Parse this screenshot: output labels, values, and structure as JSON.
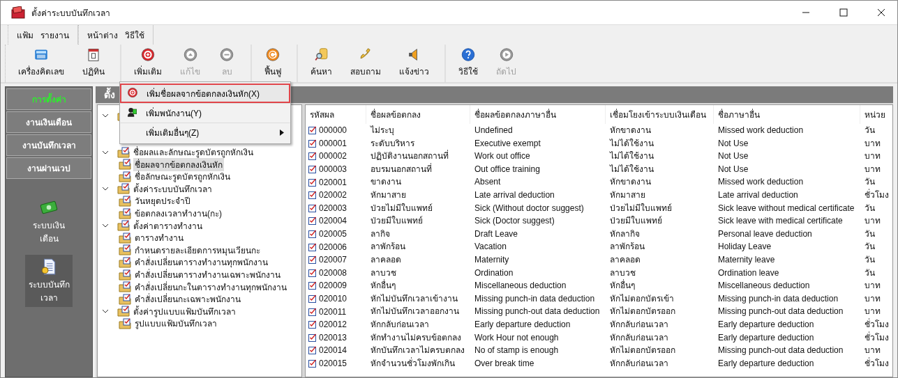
{
  "window": {
    "title": "ตั้งค่าระบบบันทึกเวลา"
  },
  "menu_groups": [
    [
      "แฟ้ม",
      "รายงาน"
    ],
    [
      "หน้าต่าง",
      "วิธีใช้"
    ]
  ],
  "toolbar_groups": [
    [
      {
        "label": "เครื่องคิดเลข",
        "disabled": false
      },
      {
        "label": "ปฏิทิน",
        "disabled": false
      }
    ],
    [
      {
        "label": "เพิ่มเติม",
        "disabled": false
      },
      {
        "label": "แก้ไข",
        "disabled": true
      },
      {
        "label": "ลบ",
        "disabled": true
      }
    ],
    [
      {
        "label": "ฟื้นฟู",
        "disabled": false
      }
    ],
    [
      {
        "label": "ค้นหา",
        "disabled": false
      },
      {
        "label": "สอบถาม",
        "disabled": false
      },
      {
        "label": "แจ้งข่าว",
        "disabled": false
      }
    ],
    [
      {
        "label": "วิธีใช้",
        "disabled": false
      },
      {
        "label": "ถัดไป",
        "disabled": true
      }
    ]
  ],
  "nav_buttons": [
    {
      "label": "การตั้งค่า",
      "selected": true
    },
    {
      "label": "งานเงินเดือน",
      "selected": false
    },
    {
      "label": "งานบันทึกเวลา",
      "selected": false
    },
    {
      "label": "งานผ่านเวป",
      "selected": false
    }
  ],
  "nav_modules": [
    {
      "label": "ระบบเงินเดือน",
      "selected": false
    },
    {
      "label": "ระบบบันทึกเวลา",
      "selected": true
    }
  ],
  "panel": {
    "title": "ตั้ง"
  },
  "tree": [
    {
      "expanded": true
    },
    {
      "label": "ชื่อผลและลักษณะรูดบัตรถูกหักเงิน",
      "expanded": true,
      "children": [
        {
          "label": "ชื่อผลจากข้อตกลงเงินหัก",
          "selected": true
        },
        {
          "label": "ชื่อลักษณะรูดบัตรถูกหักเงิน",
          "selected": false
        }
      ]
    },
    {
      "label": "ตั้งค่าระบบบันทึกเวลา",
      "expanded": true,
      "children": [
        {
          "label": "วันหยุดประจำปี",
          "selected": false
        },
        {
          "label": "ข้อตกลงเวลาทำงาน(กะ)",
          "selected": false
        }
      ]
    },
    {
      "label": "ตั้งค่าตารางทำงาน",
      "expanded": true,
      "children": [
        {
          "label": "ตารางทำงาน",
          "selected": false
        },
        {
          "label": "กำหนดรายละเอียดการหมุนเวียนกะ",
          "selected": false
        },
        {
          "label": "คำสั่งเปลี่ยนตารางทำงานทุกพนักงาน",
          "selected": false
        },
        {
          "label": "คำสั่งเปลี่ยนตารางทำงานเฉพาะพนักงาน",
          "selected": false
        },
        {
          "label": "คำสั่งเปลี่ยนกะในตารางทำงานทุกพนักงาน",
          "selected": false
        },
        {
          "label": "คำสั่งเปลี่ยนกะเฉพาะพนักงาน",
          "selected": false
        }
      ]
    },
    {
      "label": "ตั้งค่ารูปแบบแฟ้มบันทึกเวลา",
      "expanded": true,
      "children": [
        {
          "label": "รูปแบบแฟ้มบันทึกเวลา",
          "selected": false
        }
      ]
    }
  ],
  "popup_menu": [
    {
      "label": "เพิ่มชื่อผลจากข้อตกลงเงินหัก(X)",
      "selected": true,
      "submenu": false
    },
    {
      "label": "เพิ่มพนักงาน(Y)",
      "selected": false,
      "submenu": false
    },
    {
      "label": "เพิ่มเติมอื่นๆ(Z)",
      "selected": false,
      "submenu": true
    }
  ],
  "table": {
    "columns": [
      "รหัสผล",
      "ชื่อผลข้อตกลง",
      "ชื่อผลข้อตกลงภาษาอื่น",
      "เชื่อมโยงเข้าระบบเงินเดือน",
      "ชื่อภาษาอื่น",
      "หน่วย"
    ],
    "rows": [
      [
        "000000",
        "ไม่ระบุ",
        "Undefined",
        "หักขาดงาน",
        "Missed work deduction",
        "วัน"
      ],
      [
        "000001",
        "ระดับบริหาร",
        "Executive exempt",
        "ไม่ได้ใช้งาน",
        "Not Use",
        "บาท"
      ],
      [
        "000002",
        "ปฏิบัติงานนอกสถานที่",
        "Work out office",
        "ไม่ได้ใช้งาน",
        "Not Use",
        "บาท"
      ],
      [
        "000003",
        "อบรมนอกสถานที่",
        "Out office training",
        "ไม่ได้ใช้งาน",
        "Not Use",
        "บาท"
      ],
      [
        "020001",
        "ขาดงาน",
        "Absent",
        "หักขาดงาน",
        "Missed work deduction",
        "วัน"
      ],
      [
        "020002",
        "หักมาสาย",
        "Late arrival deduction",
        "หักมาสาย",
        "Late arrival deduction",
        "ชั่วโมง"
      ],
      [
        "020003",
        "ป่วยไม่มีใบแพทย์",
        "Sick (Without doctor suggest)",
        "ป่วยไม่มีใบแพทย์",
        "Sick leave without medical certificate",
        "วัน"
      ],
      [
        "020004",
        "ป่วยมีใบแพทย์",
        "Sick (Doctor suggest)",
        "ป่วยมีใบแพทย์",
        "Sick leave with medical certificate",
        "บาท"
      ],
      [
        "020005",
        "ลากิจ",
        "Draft Leave",
        "หักลากิจ",
        "Personal leave deduction",
        "วัน"
      ],
      [
        "020006",
        "ลาพักร้อน",
        "Vacation",
        "ลาพักร้อน",
        "Holiday Leave",
        "วัน"
      ],
      [
        "020007",
        "ลาคลอด",
        "Maternity",
        "ลาคลอด",
        "Maternity leave",
        "วัน"
      ],
      [
        "020008",
        "ลาบวช",
        "Ordination",
        "ลาบวช",
        "Ordination leave",
        "วัน"
      ],
      [
        "020009",
        "หักอื่นๆ",
        "Miscellaneous deduction",
        "หักอื่นๆ",
        "Miscellaneous deduction",
        "บาท"
      ],
      [
        "020010",
        "หักไม่บันทึกเวลาเข้างาน",
        "Missing punch-in data deduction",
        "หักไม่ตอกบัตรเข้า",
        "Missing punch-in data deduction",
        "บาท"
      ],
      [
        "020011",
        "หักไม่บันทึกเวลาออกงาน",
        "Missing punch-out data deduction",
        "หักไม่ตอกบัตรออก",
        "Missing punch-out data deduction",
        "บาท"
      ],
      [
        "020012",
        "หักกลับก่อนเวลา",
        "Early departure deduction",
        "หักกลับก่อนเวลา",
        "Early departure deduction",
        "ชั่วโมง"
      ],
      [
        "020013",
        "หักทำงานไม่ครบข้อตกลง",
        "Work Hour not enough",
        "หักกลับก่อนเวลา",
        "Early departure deduction",
        "ชั่วโมง"
      ],
      [
        "020014",
        "หักบันทึกเวลาไม่ครบตกลง",
        "No of stamp is enough",
        "หักไม่ตอกบัตรออก",
        "Missing punch-out data deduction",
        "บาท"
      ],
      [
        "020015",
        "หักจำนวนชั่วโมงพักเกิน",
        "Over break time",
        "หักกลับก่อนเวลา",
        "Early departure deduction",
        "ชั่วโมง"
      ]
    ]
  }
}
